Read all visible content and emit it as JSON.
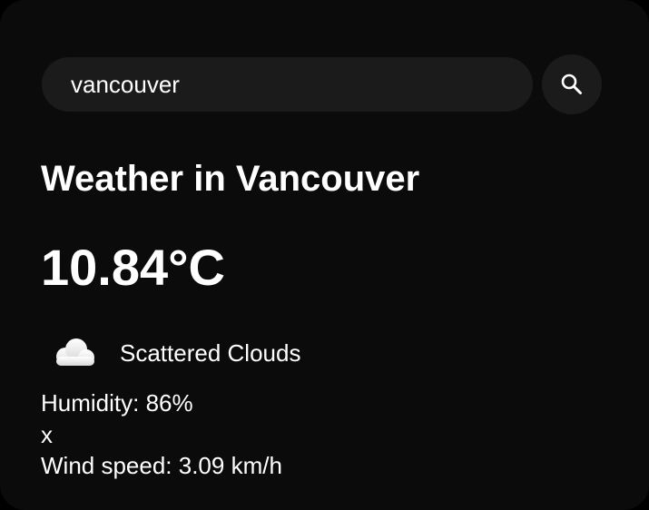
{
  "search": {
    "value": "vancouver",
    "button_icon": "search-icon"
  },
  "weather": {
    "title": "Weather in Vancouver",
    "temperature": "10.84°C",
    "condition_icon": "cloud-icon",
    "condition": "Scattered Clouds",
    "humidity": "Humidity: 86%",
    "stray_text": "x",
    "wind": "Wind speed: 3.09 km/h"
  },
  "colors": {
    "background": "#0b0b0b",
    "surface": "#1b1b1b",
    "text": "#ffffff"
  }
}
